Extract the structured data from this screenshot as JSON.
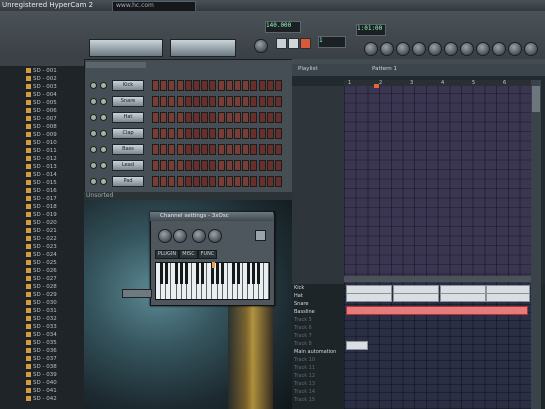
{
  "window": {
    "title": "Unregistered HyperCam 2",
    "hint_text": "www.hc.com"
  },
  "toolbar": {
    "tempo_display": "140.000",
    "pattern_display": "1",
    "song_position": "1:01:00"
  },
  "browser": {
    "items": [
      "SD - 001",
      "SD - 002",
      "SD - 003",
      "SD - 004",
      "SD - 005",
      "SD - 006",
      "SD - 007",
      "SD - 008",
      "SD - 009",
      "SD - 010",
      "SD - 011",
      "SD - 012",
      "SD - 013",
      "SD - 014",
      "SD - 015",
      "SD - 016",
      "SD - 017",
      "SD - 018",
      "SD - 019",
      "SD - 020",
      "SD - 021",
      "SD - 022",
      "SD - 023",
      "SD - 024",
      "SD - 025",
      "SD - 026",
      "SD - 027",
      "SD - 028",
      "SD - 029",
      "SD - 030",
      "SD - 031",
      "SD - 032",
      "SD - 033",
      "SD - 034",
      "SD - 035",
      "SD - 036",
      "SD - 037",
      "SD - 038",
      "SD - 039",
      "SD - 040",
      "SD - 041",
      "SD - 042"
    ]
  },
  "step_sequencer": {
    "channels": [
      "Kick",
      "Snare",
      "Hat",
      "Clap",
      "Bass",
      "Lead",
      "Pad"
    ],
    "footer": "Unsorted"
  },
  "channel_settings": {
    "title": "Channel settings - 3xOsc",
    "tabs": [
      "PLUGIN",
      "MISC",
      "FUNC"
    ]
  },
  "playlist": {
    "title_left": "Playlist",
    "title_right": "Pattern 1",
    "ruler": [
      "1",
      "2",
      "3",
      "4",
      "5",
      "6"
    ],
    "tracks": [
      "Kick",
      "Hat",
      "Snare",
      "Bassline",
      "Track 5",
      "Track 6",
      "Track 7",
      "Track 8",
      "Main automation",
      "Track 10",
      "Track 11",
      "Track 12",
      "Track 13",
      "Track 14",
      "Track 15"
    ]
  },
  "colors": {
    "clip_red": "#e77a7a",
    "clip_white": "#d9dee2",
    "step_red": "#7a3d36",
    "marker_orange": "#e2673a"
  }
}
